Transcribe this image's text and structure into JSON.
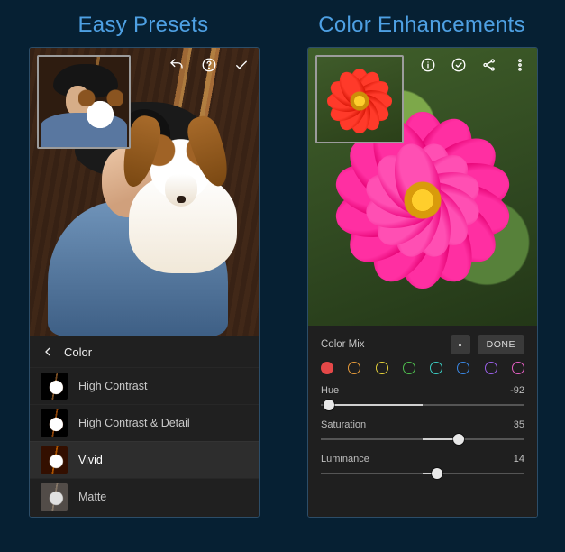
{
  "left": {
    "title": "Easy Presets",
    "header_label": "Color",
    "icons": {
      "undo": "undo-icon",
      "help": "help-icon",
      "confirm": "check-icon"
    },
    "presets": [
      {
        "label": "High Contrast",
        "selected": false
      },
      {
        "label": "High Contrast & Detail",
        "selected": false
      },
      {
        "label": "Vivid",
        "selected": true
      },
      {
        "label": "Matte",
        "selected": false
      }
    ]
  },
  "right": {
    "title": "Color Enhancements",
    "icons": {
      "help": "help-icon",
      "confirm": "check-circle-icon",
      "share": "share-icon",
      "more": "more-vert-icon"
    },
    "mix_label": "Color Mix",
    "done_label": "DONE",
    "swatches": [
      "#e54848",
      "#e59a3a",
      "#e6d23a",
      "#4fbf4f",
      "#3bccc2",
      "#3a88e6",
      "#9a5fe6",
      "#e65fc4"
    ],
    "selected_swatch_index": 0,
    "sliders": {
      "hue": {
        "label": "Hue",
        "value": -92,
        "min": -100,
        "max": 100
      },
      "saturation": {
        "label": "Saturation",
        "value": 35,
        "min": -100,
        "max": 100
      },
      "luminance": {
        "label": "Luminance",
        "value": 14,
        "min": -100,
        "max": 100
      }
    }
  }
}
